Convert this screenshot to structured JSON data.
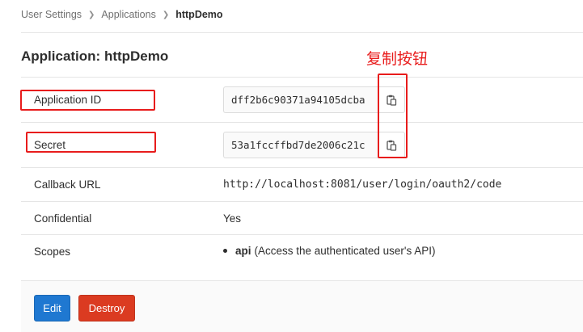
{
  "breadcrumb": {
    "items": [
      "User Settings",
      "Applications"
    ],
    "current": "httpDemo"
  },
  "page": {
    "title": "Application: httpDemo"
  },
  "details": {
    "application_id": {
      "label": "Application ID",
      "value": "dff2b6c90371a94105dcba"
    },
    "secret": {
      "label": "Secret",
      "value": "53a1fccffbd7de2006c21c"
    },
    "callback_url": {
      "label": "Callback URL",
      "value": "http://localhost:8081/user/login/oauth2/code"
    },
    "confidential": {
      "label": "Confidential",
      "value": "Yes"
    },
    "scopes": {
      "label": "Scopes",
      "items": [
        {
          "name": "api",
          "description": "(Access the authenticated user's API)"
        }
      ]
    }
  },
  "actions": {
    "edit_label": "Edit",
    "destroy_label": "Destroy"
  },
  "annotation": {
    "text": "复制按钮",
    "color": "#e81c1c"
  },
  "colors": {
    "edit_button": "#1f78d1",
    "destroy_button": "#db3b21"
  },
  "icons": {
    "copy": "clipboard-icon",
    "separator": "chevron-right-icon"
  }
}
